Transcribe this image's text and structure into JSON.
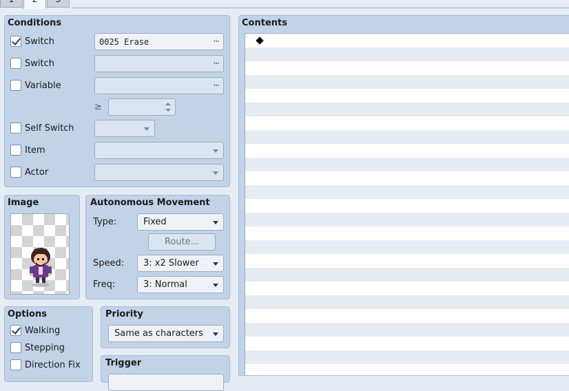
{
  "tabs": [
    {
      "label": "1",
      "active": false
    },
    {
      "label": "2",
      "active": true
    },
    {
      "label": "3",
      "active": false
    }
  ],
  "conditions": {
    "title": "Conditions",
    "switch1": {
      "label": "Switch",
      "checked": true,
      "value": "0025 Erase",
      "button": "···"
    },
    "switch2": {
      "label": "Switch",
      "checked": false,
      "value": "",
      "button": "···"
    },
    "variable": {
      "label": "Variable",
      "checked": false,
      "value": "",
      "button": "···",
      "comparator": "≥",
      "compare_value": ""
    },
    "self_switch": {
      "label": "Self Switch",
      "checked": false,
      "value": ""
    },
    "item": {
      "label": "Item",
      "checked": false,
      "value": ""
    },
    "actor": {
      "label": "Actor",
      "checked": false,
      "value": ""
    }
  },
  "image": {
    "title": "Image"
  },
  "autonomous_movement": {
    "title": "Autonomous Movement",
    "type_label": "Type:",
    "type_value": "Fixed",
    "route_button": "Route...",
    "speed_label": "Speed:",
    "speed_value": "3: x2 Slower",
    "freq_label": "Freq:",
    "freq_value": "3: Normal"
  },
  "options": {
    "title": "Options",
    "walking": {
      "label": "Walking",
      "checked": true
    },
    "stepping": {
      "label": "Stepping",
      "checked": false
    },
    "direction_fix": {
      "label": "Direction Fix",
      "checked": false
    }
  },
  "priority": {
    "title": "Priority",
    "value": "Same as characters"
  },
  "trigger": {
    "title": "Trigger"
  },
  "contents": {
    "title": "Contents"
  },
  "colors": {
    "panel": "#c2d3e8",
    "background": "#e6ecf4",
    "row_alt": "#e6ecf4"
  }
}
